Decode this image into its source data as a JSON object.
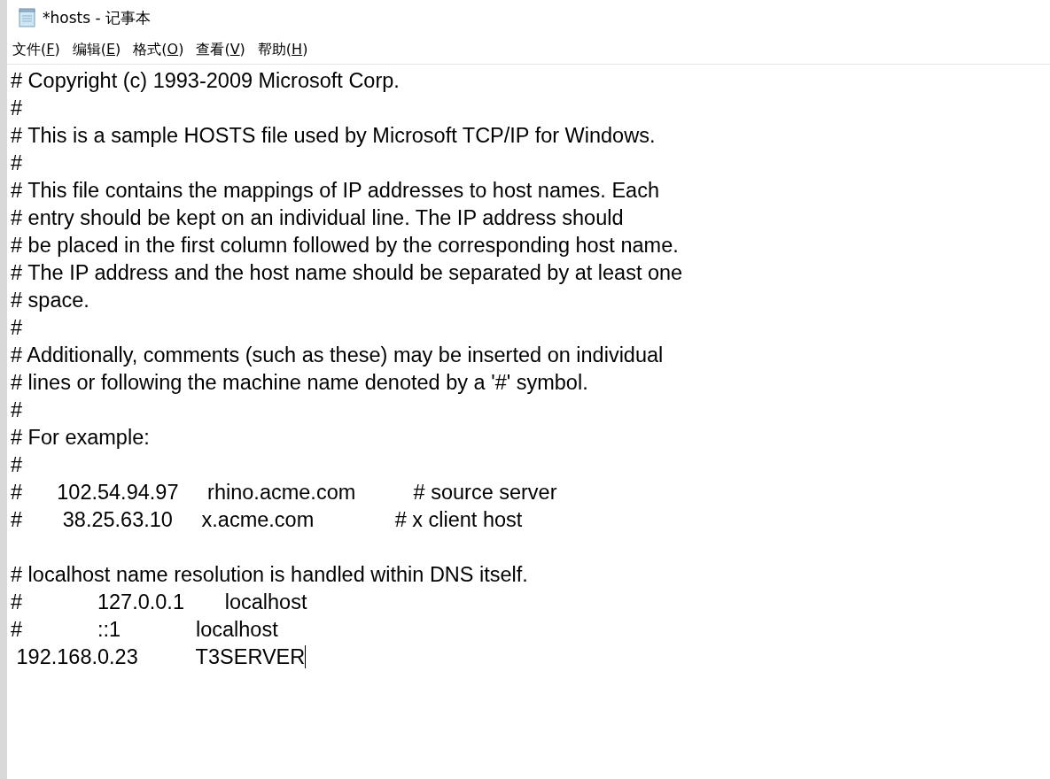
{
  "window": {
    "title": "*hosts - 记事本"
  },
  "menu": [
    {
      "label": "文件(F)"
    },
    {
      "label": "编辑(E)"
    },
    {
      "label": "格式(O)"
    },
    {
      "label": "查看(V)"
    },
    {
      "label": "帮助(H)"
    }
  ],
  "editor": {
    "lines": [
      {
        "kind": "text",
        "text": "# Copyright (c) 1993-2009 Microsoft Corp."
      },
      {
        "kind": "text",
        "text": "#"
      },
      {
        "kind": "text",
        "text": "# This is a sample HOSTS file used by Microsoft TCP/IP for Windows."
      },
      {
        "kind": "text",
        "text": "#"
      },
      {
        "kind": "text",
        "text": "# This file contains the mappings of IP addresses to host names. Each"
      },
      {
        "kind": "text",
        "text": "# entry should be kept on an individual line. The IP address should"
      },
      {
        "kind": "text",
        "text": "# be placed in the first column followed by the corresponding host name."
      },
      {
        "kind": "text",
        "text": "# The IP address and the host name should be separated by at least one"
      },
      {
        "kind": "text",
        "text": "# space."
      },
      {
        "kind": "text",
        "text": "#"
      },
      {
        "kind": "text",
        "text": "# Additionally, comments (such as these) may be inserted on individual"
      },
      {
        "kind": "text",
        "text": "# lines or following the machine name denoted by a '#' symbol."
      },
      {
        "kind": "text",
        "text": "#"
      },
      {
        "kind": "text",
        "text": "# For example:"
      },
      {
        "kind": "text",
        "text": "#"
      },
      {
        "kind": "text",
        "text": "#      102.54.94.97     rhino.acme.com          # source server"
      },
      {
        "kind": "text",
        "text": "#       38.25.63.10     x.acme.com              # x client host"
      },
      {
        "kind": "blank"
      },
      {
        "kind": "text",
        "text": "# localhost name resolution is handled within DNS itself."
      },
      {
        "kind": "text",
        "text": "#             127.0.0.1       localhost"
      },
      {
        "kind": "text",
        "text": "#             ::1             localhost"
      },
      {
        "kind": "text",
        "text": " 192.168.0.23          T3SERVER",
        "cursor": true
      }
    ]
  }
}
